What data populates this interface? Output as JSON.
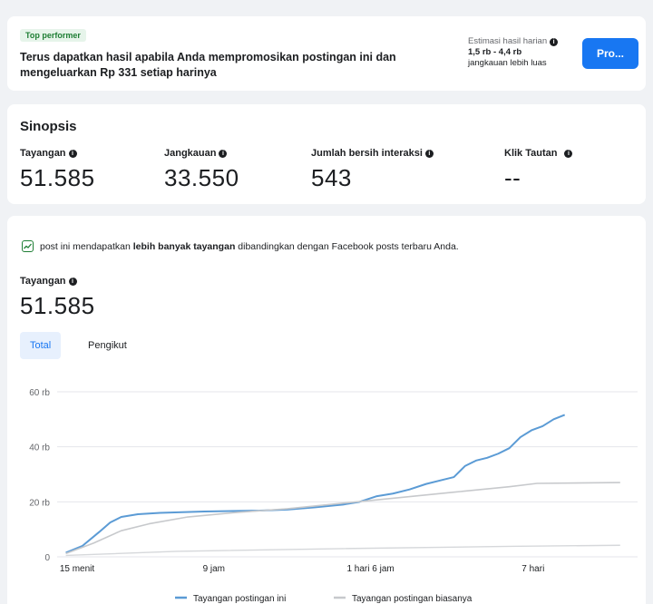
{
  "promo": {
    "badge": "Top performer",
    "text": "Terus dapatkan hasil apabila Anda mempromosikan postingan ini dan mengeluarkan Rp 331 setiap harinya",
    "estimate_title": "Estimasi hasil harian",
    "estimate_range": "1,5 rb - 4,4 rb",
    "estimate_sub": "jangkauan lebih luas",
    "button_label": "Pro..."
  },
  "synopsis": {
    "title": "Sinopsis",
    "metrics": [
      {
        "label": "Tayangan",
        "value": "51.585"
      },
      {
        "label": "Jangkauan",
        "value": "33.550"
      },
      {
        "label": "Jumlah bersih interaksi",
        "value": "543"
      },
      {
        "label": "Klik Tautan",
        "value": "--"
      }
    ]
  },
  "insight": {
    "prefix": "post ini mendapatkan ",
    "bold": "lebih banyak tayangan",
    "suffix": " dibandingkan dengan Facebook posts terbaru Anda."
  },
  "views": {
    "label": "Tayangan",
    "value": "51.585"
  },
  "tabs": [
    {
      "label": "Total",
      "active": true
    },
    {
      "label": "Pengikut",
      "active": false
    }
  ],
  "colors": {
    "accent": "#1877f2",
    "series_primary": "#5b9bd5",
    "series_secondary": "#c7c9cc",
    "badge_green": "#1e7e34"
  },
  "chart_data": {
    "type": "line",
    "ylim": [
      0,
      60000
    ],
    "y_ticks": [
      {
        "value": 0,
        "label": "0"
      },
      {
        "value": 20000,
        "label": "20 rb"
      },
      {
        "value": 40000,
        "label": "40 rb"
      },
      {
        "value": 60000,
        "label": "60 rb"
      }
    ],
    "x_range": [
      0,
      100
    ],
    "x_ticks": [
      {
        "value": 0,
        "label": "15 menit"
      },
      {
        "value": 27,
        "label": "9 jam"
      },
      {
        "value": 54,
        "label": "1 hari 6 jam"
      },
      {
        "value": 82,
        "label": "7 hari"
      }
    ],
    "series": [
      {
        "name": "Tayangan postingan ini",
        "points": [
          [
            0,
            1500
          ],
          [
            3,
            4000
          ],
          [
            6,
            9000
          ],
          [
            8,
            12500
          ],
          [
            10,
            14500
          ],
          [
            13,
            15500
          ],
          [
            17,
            16000
          ],
          [
            25,
            16500
          ],
          [
            35,
            16800
          ],
          [
            40,
            17200
          ],
          [
            45,
            18000
          ],
          [
            50,
            19000
          ],
          [
            53,
            20000
          ],
          [
            56,
            22000
          ],
          [
            59,
            23000
          ],
          [
            62,
            24500
          ],
          [
            65,
            26500
          ],
          [
            68,
            28000
          ],
          [
            70,
            29000
          ],
          [
            72,
            33000
          ],
          [
            74,
            35000
          ],
          [
            76,
            36000
          ],
          [
            78,
            37500
          ],
          [
            80,
            39500
          ],
          [
            82,
            43500
          ],
          [
            84,
            46000
          ],
          [
            86,
            47500
          ],
          [
            88,
            50000
          ],
          [
            90,
            51600
          ]
        ]
      },
      {
        "name": "Tayangan postingan biasanya",
        "points": [
          [
            0,
            1200
          ],
          [
            5,
            5000
          ],
          [
            10,
            9500
          ],
          [
            15,
            12000
          ],
          [
            22,
            14500
          ],
          [
            30,
            16000
          ],
          [
            40,
            17500
          ],
          [
            50,
            19500
          ],
          [
            60,
            21500
          ],
          [
            70,
            23500
          ],
          [
            80,
            25500
          ],
          [
            85,
            26700
          ],
          [
            100,
            27000
          ]
        ]
      },
      {
        "name": "",
        "points": [
          [
            0,
            500
          ],
          [
            20,
            2000
          ],
          [
            50,
            3000
          ],
          [
            80,
            3800
          ],
          [
            100,
            4200
          ]
        ]
      }
    ]
  }
}
